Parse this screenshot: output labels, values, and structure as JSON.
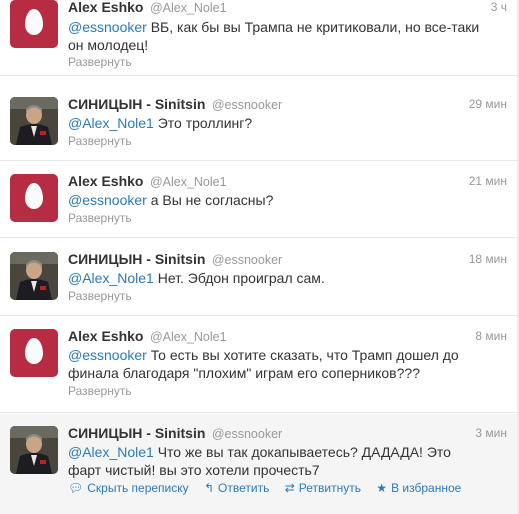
{
  "tweets": [
    {
      "name": "Alex Eshko",
      "handle": "@Alex_Nole1",
      "time": "3 ч",
      "mention": "@essnooker",
      "text_line1": " ВБ, как бы вы Трампа не критиковали, но все-таки",
      "text_line2": "он молодец!",
      "expand": "Развернуть",
      "avatar": "egg-avatar"
    },
    {
      "name": "СИНИЦЫН - Sinitsin",
      "handle": "@essnooker",
      "time": "29 мин",
      "mention": "@Alex_Nole1",
      "text_line1": " Это троллинг?",
      "expand": "Развернуть",
      "avatar": "photo-avatar"
    },
    {
      "name": "Alex Eshko",
      "handle": "@Alex_Nole1",
      "time": "21 мин",
      "mention": "@essnooker",
      "text_line1": " а Вы не согласны?",
      "expand": "Развернуть",
      "avatar": "egg-avatar"
    },
    {
      "name": "СИНИЦЫН - Sinitsin",
      "handle": "@essnooker",
      "time": "18 мин",
      "mention": "@Alex_Nole1",
      "text_line1": " Нет. Эбдон проиграл сам.",
      "expand": "Развернуть",
      "avatar": "photo-avatar"
    },
    {
      "name": "Alex Eshko",
      "handle": "@Alex_Nole1",
      "time": "8 мин",
      "mention": "@essnooker",
      "text_line1": " То есть вы хотите сказать, что Трамп дошел до",
      "text_line2": "финала благодаря \"плохим\" играм его соперников???",
      "expand": "Развернуть",
      "avatar": "egg-avatar"
    },
    {
      "name": "СИНИЦЫН - Sinitsin",
      "handle": "@essnooker",
      "time": "3 мин",
      "mention": "@Alex_Nole1",
      "text_line1": " Что же вы так докапываетесь? ДАДАДА! Это",
      "text_line2": "фарт чистый! вы это хотели прочесть7",
      "avatar": "photo-avatar",
      "actions": {
        "hide": "Скрыть переписку",
        "reply": "Ответить",
        "retweet": "Ретвитнуть",
        "favorite": "В избранное"
      }
    }
  ],
  "colors": {
    "link": "#2b7bb9",
    "egg_bg": "#b62c43",
    "meta": "#999999"
  },
  "icons": {
    "hide": "speech-bubble-icon",
    "reply": "reply-arrow-icon",
    "retweet": "retweet-icon",
    "favorite": "star-icon"
  }
}
